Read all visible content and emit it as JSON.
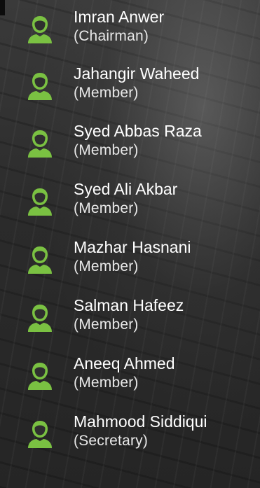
{
  "icon_color": "#7ac142",
  "members": [
    {
      "name": "Imran Anwer",
      "role": "(Chairman)",
      "icon": "user-avatar-icon"
    },
    {
      "name": "Jahangir Waheed",
      "role": "(Member)",
      "icon": "user-avatar-icon"
    },
    {
      "name": "Syed Abbas Raza",
      "role": "(Member)",
      "icon": "user-avatar-icon"
    },
    {
      "name": "Syed Ali Akbar",
      "role": "(Member)",
      "icon": "user-avatar-icon"
    },
    {
      "name": "Mazhar Hasnani",
      "role": "(Member)",
      "icon": "user-avatar-icon"
    },
    {
      "name": "Salman Hafeez",
      "role": "(Member)",
      "icon": "user-avatar-icon"
    },
    {
      "name": "Aneeq Ahmed",
      "role": "(Member)",
      "icon": "user-avatar-icon"
    },
    {
      "name": "Mahmood Siddiqui",
      "role": "(Secretary)",
      "icon": "user-avatar-icon"
    }
  ]
}
